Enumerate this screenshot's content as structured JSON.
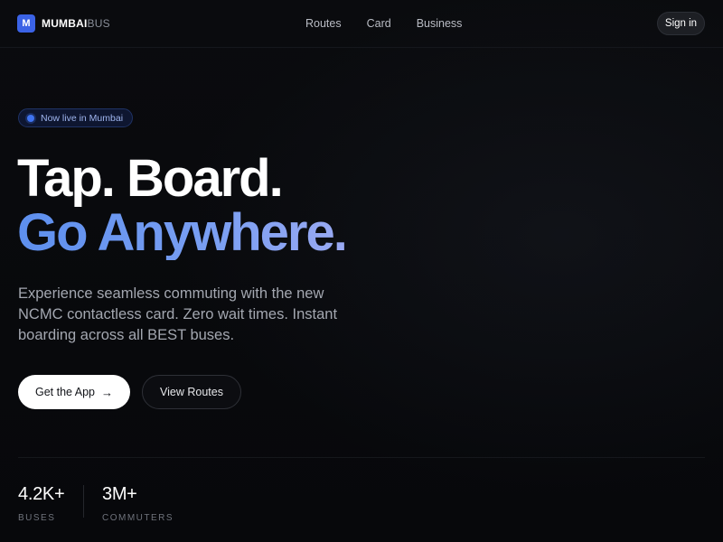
{
  "brand": {
    "mark": "M",
    "name_bold": "MUMBAI",
    "name_light": "BUS"
  },
  "nav": {
    "links": [
      "Routes",
      "Card",
      "Business"
    ],
    "signin": "Sign in"
  },
  "hero": {
    "badge": "Now live in Mumbai",
    "headline_line1": "Tap. Board.",
    "headline_line2": "Go Anywhere.",
    "lead": "Experience seamless commuting with the new NCMC contactless card. Zero wait times. Instant boarding across all BEST buses.",
    "primary_cta": "Get the App",
    "primary_cta_icon": "arrow-right-icon",
    "secondary_cta": "View Routes"
  },
  "stats": [
    {
      "value": "4.2K+",
      "label": "BUSES"
    },
    {
      "value": "3M+",
      "label": "COMMUTERS"
    }
  ],
  "colors": {
    "background": "#07080b",
    "accent": "#3b63e6",
    "gradient_start": "#5d8fee",
    "gradient_end": "#9aa9f2"
  }
}
